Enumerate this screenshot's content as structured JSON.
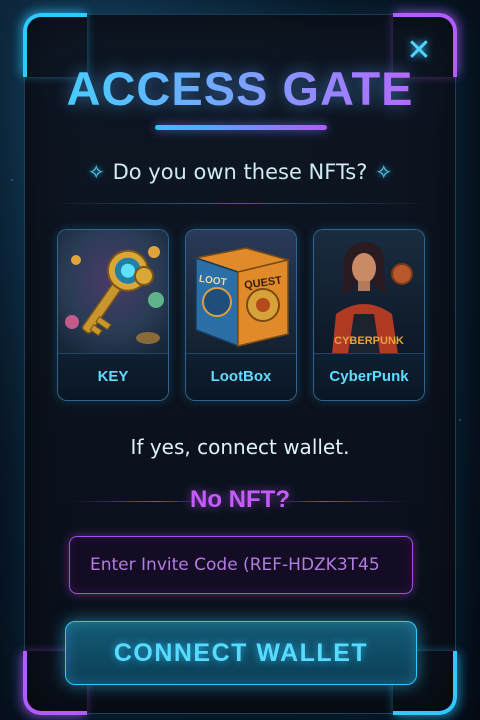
{
  "modal": {
    "title": "ACCESS GATE",
    "close_symbol": "✕",
    "question": "Do you own these NFTs?",
    "sparkle_icon": "✧",
    "connect_hint": "If yes, connect wallet.",
    "no_nft_label": "No NFT?",
    "invite_placeholder": "Enter Invite Code (REF-HDZK3T45",
    "connect_button_label": "CONNECT WALLET"
  },
  "nft_cards": [
    {
      "label": "KEY",
      "icon": "key-art"
    },
    {
      "label": "LootBox",
      "icon": "lootbox-art",
      "art_text": [
        "LOOT",
        "QUEST"
      ]
    },
    {
      "label": "CyberPunk",
      "icon": "cyberpunk-art",
      "art_text": "CYBERPUNK"
    }
  ],
  "colors": {
    "cyan": "#2fc8ff",
    "purple": "#b05cff",
    "background": "#081523"
  }
}
